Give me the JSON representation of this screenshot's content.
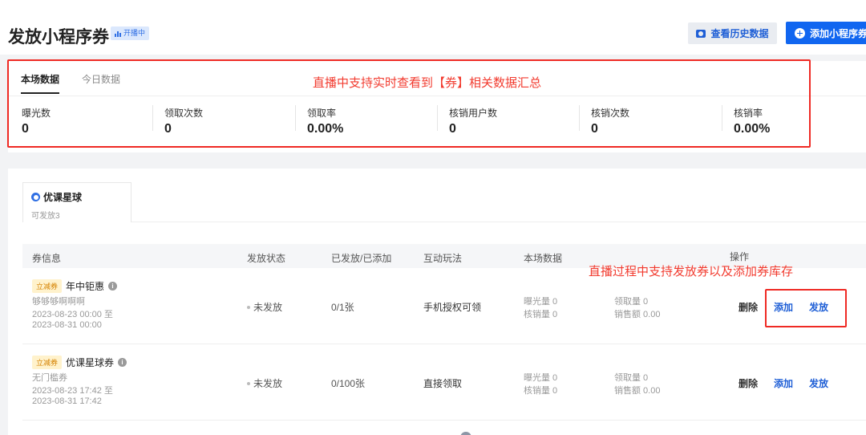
{
  "header": {
    "title": "发放小程序券",
    "live_badge": "开播中",
    "history_button": "查看历史数据",
    "add_button": "添加小程序券"
  },
  "stats": {
    "tabs": [
      {
        "label": "本场数据",
        "active": true
      },
      {
        "label": "今日数据",
        "active": false
      }
    ],
    "annotation": "直播中支持实时查看到【券】相关数据汇总",
    "items": [
      {
        "label": "曝光数",
        "value": "0"
      },
      {
        "label": "领取次数",
        "value": "0"
      },
      {
        "label": "领取率",
        "value": "0.00%"
      },
      {
        "label": "核销用户数",
        "value": "0"
      },
      {
        "label": "核销次数",
        "value": "0"
      },
      {
        "label": "核销率",
        "value": "0.00%"
      }
    ]
  },
  "shop_tab": {
    "name": "优课星球",
    "sub": "可发放3"
  },
  "table": {
    "columns": [
      "券信息",
      "发放状态",
      "已发放/已添加",
      "互动玩法",
      "本场数据",
      "操作"
    ],
    "annotation": "直播过程中支持发放券以及添加券库存",
    "rows": [
      {
        "type": "立减券",
        "name": "年中钜惠",
        "desc": "够够够啊啊啊",
        "time_start": "2023-08-23 00:00 至",
        "time_end": "2023-08-31 00:00",
        "status": "未发放",
        "issued": "0/1张",
        "mode": "手机授权可领",
        "exposure": "曝光量 0",
        "redeemed": "核销量 0",
        "claimed": "领取量 0",
        "sales": "销售额 0.00",
        "actions": {
          "delete": "删除",
          "add": "添加",
          "issue": "发放"
        }
      },
      {
        "type": "立减券",
        "name": "优课星球券",
        "desc": "无门槛券",
        "time_start": "2023-08-23 17:42 至",
        "time_end": "2023-08-31 17:42",
        "status": "未发放",
        "issued": "0/100张",
        "mode": "直接领取",
        "exposure": "曝光量 0",
        "redeemed": "核销量 0",
        "claimed": "领取量 0",
        "sales": "销售额 0.00",
        "actions": {
          "delete": "删除",
          "add": "添加",
          "issue": "发放"
        }
      }
    ]
  },
  "colors": {
    "accent": "#1166f0",
    "annotation": "#f23b2f",
    "badge_bg": "#fff2cc"
  }
}
